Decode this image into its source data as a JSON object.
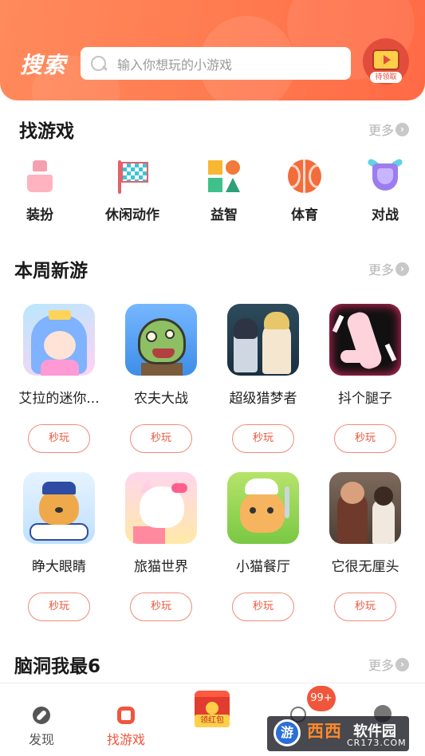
{
  "header": {
    "title": "搜索",
    "search_placeholder": "输入你想玩的小游戏",
    "gift_label": "待领取"
  },
  "find_games": {
    "title": "找游戏",
    "more": "更多",
    "categories": [
      {
        "label": "装扮",
        "icon": "dress-icon"
      },
      {
        "label": "休闲动作",
        "icon": "flag-icon"
      },
      {
        "label": "益智",
        "icon": "puzzle-shapes-icon"
      },
      {
        "label": "体育",
        "icon": "ball-icon"
      },
      {
        "label": "对战",
        "icon": "shield-icon"
      }
    ]
  },
  "weekly_new": {
    "title": "本周新游",
    "more": "更多",
    "play_label": "秒玩",
    "games": [
      {
        "name": "艾拉的迷你..."
      },
      {
        "name": "农夫大战"
      },
      {
        "name": "超级猎梦者"
      },
      {
        "name": "抖个腿子"
      },
      {
        "name": "睁大眼睛"
      },
      {
        "name": "旅猫世界"
      },
      {
        "name": "小猫餐厅"
      },
      {
        "name": "它很无厘头"
      }
    ]
  },
  "brain_hole": {
    "title": "脑洞我最6",
    "more": "更多"
  },
  "bottom_nav": {
    "discover": "发现",
    "find_games": "找游戏",
    "redpack_label": "领红包",
    "badge": "99+"
  },
  "watermark": {
    "circle": "游",
    "main": "西西",
    "soft": "软件园",
    "url": "CR173.COM"
  },
  "colors": {
    "accent": "#f0563c",
    "header_gradient_start": "#ff8a5c",
    "header_gradient_end": "#ff6a45"
  }
}
